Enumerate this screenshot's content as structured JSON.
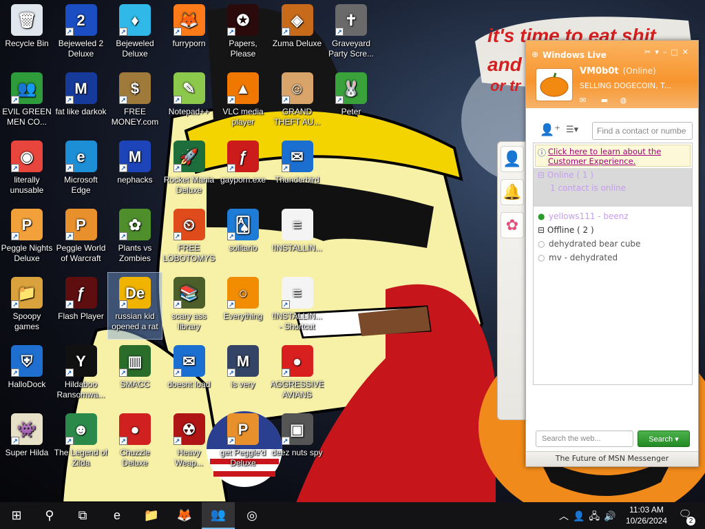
{
  "wallpaper": {
    "caption_lines": [
      "it's time to eat shit",
      "and",
      "or tr"
    ]
  },
  "desktop_icons": [
    {
      "label": "Recycle Bin",
      "icon": "recycle-bin-icon",
      "shortcut": false,
      "glyph": "🗑",
      "bg": "#dfe6ee"
    },
    {
      "label": "EVIL GREEN MEN CO...",
      "icon": "msn-buddies-icon",
      "shortcut": true,
      "glyph": "👥",
      "bg": "#2e9c3a"
    },
    {
      "label": "literally unusable",
      "icon": "chrome-icon",
      "shortcut": true,
      "glyph": "◉",
      "bg": "#e8453c"
    },
    {
      "label": "Peggle Nights Deluxe",
      "icon": "peggle-icon",
      "shortcut": true,
      "glyph": "P",
      "bg": "#f2a03a"
    },
    {
      "label": "Spoopy games",
      "icon": "folder-icon",
      "shortcut": true,
      "glyph": "📁",
      "bg": "#d9a23d"
    },
    {
      "label": "HalloDock",
      "icon": "shield-icon",
      "shortcut": true,
      "glyph": "⛨",
      "bg": "#1f6fd1"
    },
    {
      "label": "Super Hilda",
      "icon": "pixel-game-icon",
      "shortcut": true,
      "glyph": "👾",
      "bg": "#e7e1c8"
    },
    {
      "label": "Bejeweled 2 Deluxe",
      "icon": "bejeweled-2-icon",
      "shortcut": true,
      "glyph": "2",
      "bg": "#1b4ec2"
    },
    {
      "label": "fat like darkok",
      "icon": "mpl-icon",
      "shortcut": true,
      "glyph": "M",
      "bg": "#163a9a"
    },
    {
      "label": "Microsoft Edge",
      "icon": "edge-icon",
      "shortcut": true,
      "glyph": "e",
      "bg": "#1c8fd6"
    },
    {
      "label": "Peggle World of Warcraft",
      "icon": "peggle-icon",
      "shortcut": true,
      "glyph": "P",
      "bg": "#e8902c"
    },
    {
      "label": "Flash Player",
      "icon": "flash-icon",
      "shortcut": true,
      "glyph": "ƒ",
      "bg": "#5e0e0e"
    },
    {
      "label": "Hildaboo Ransomwa...",
      "icon": "ransomware-icon",
      "shortcut": true,
      "glyph": "Y",
      "bg": "#111111"
    },
    {
      "label": "The Legend of Zilda",
      "icon": "character-icon",
      "shortcut": true,
      "glyph": "☻",
      "bg": "#2b8a4a"
    },
    {
      "label": "Bejeweled Deluxe",
      "icon": "gem-icon",
      "shortcut": true,
      "glyph": "♦",
      "bg": "#2fb8e8"
    },
    {
      "label": "FREE MONEY.com",
      "icon": "money-bag-icon",
      "shortcut": true,
      "glyph": "$",
      "bg": "#a07a3a"
    },
    {
      "label": "nephacks",
      "icon": "mpi-icon",
      "shortcut": true,
      "glyph": "M",
      "bg": "#1d44b8"
    },
    {
      "label": "Plants vs Zombies",
      "icon": "plant-icon",
      "shortcut": true,
      "glyph": "✿",
      "bg": "#4e8f2c"
    },
    {
      "label": "russian kid opened a rat",
      "icon": "de-icon",
      "shortcut": true,
      "glyph": "De",
      "bg": "#f0b400",
      "selected": true
    },
    {
      "label": "SMACC",
      "icon": "bars-icon",
      "shortcut": true,
      "glyph": "▥",
      "bg": "#2a6c2a"
    },
    {
      "label": "Chuzzle Deluxe",
      "icon": "chuzzle-icon",
      "shortcut": true,
      "glyph": "●",
      "bg": "#d02020"
    },
    {
      "label": "furryporn",
      "icon": "firefox-icon",
      "shortcut": true,
      "glyph": "🦊",
      "bg": "#ff7a18"
    },
    {
      "label": "Notepad++",
      "icon": "notepad-icon",
      "shortcut": true,
      "glyph": "✎",
      "bg": "#8cc84b"
    },
    {
      "label": "Rocket Mania Deluxe",
      "icon": "rocket-icon",
      "shortcut": true,
      "glyph": "🚀",
      "bg": "#1e6e3c"
    },
    {
      "label": "FREE LOBOTOMYS",
      "icon": "clock-icon",
      "shortcut": true,
      "glyph": "⏲",
      "bg": "#e04b1c"
    },
    {
      "label": "scary ass library",
      "icon": "library-icon",
      "shortcut": true,
      "glyph": "📚",
      "bg": "#4c5f2a"
    },
    {
      "label": "doesnt load",
      "icon": "thunderbird-icon",
      "shortcut": true,
      "glyph": "✉",
      "bg": "#1b6fd1"
    },
    {
      "label": "Heavy Weap...",
      "icon": "radiation-icon",
      "shortcut": true,
      "glyph": "☢",
      "bg": "#b01515"
    },
    {
      "label": "Papers, Please",
      "icon": "papers-icon",
      "shortcut": true,
      "glyph": "✪",
      "bg": "#2a0a0a"
    },
    {
      "label": "VLC media player",
      "icon": "vlc-icon",
      "shortcut": true,
      "glyph": "▲",
      "bg": "#f07800"
    },
    {
      "label": "gayporn.exe",
      "icon": "flash-icon",
      "shortcut": true,
      "glyph": "ƒ",
      "bg": "#cc1b1b"
    },
    {
      "label": "solitario",
      "icon": "solitaire-icon",
      "shortcut": true,
      "glyph": "🂡",
      "bg": "#1e7bd6"
    },
    {
      "label": "Everything",
      "icon": "search-ring-icon",
      "shortcut": true,
      "glyph": "○",
      "bg": "#f28c00"
    },
    {
      "label": "is very",
      "icon": "mpl-icon",
      "shortcut": true,
      "glyph": "M",
      "bg": "#334466"
    },
    {
      "label": "get Peggle'd Deluxe",
      "icon": "peggle-icon",
      "shortcut": true,
      "glyph": "P",
      "bg": "#e8902c"
    },
    {
      "label": "Zuma Deluxe",
      "icon": "zuma-icon",
      "shortcut": true,
      "glyph": "◈",
      "bg": "#c76b1a"
    },
    {
      "label": "GRAND THEFT AU...",
      "icon": "character-icon",
      "shortcut": true,
      "glyph": "☺",
      "bg": "#d8a46a"
    },
    {
      "label": "Thunderbird",
      "icon": "thunderbird-icon",
      "shortcut": true,
      "glyph": "✉",
      "bg": "#1b6fd1"
    },
    {
      "label": "!INSTALLIN...",
      "icon": "document-icon",
      "shortcut": false,
      "glyph": "≡",
      "bg": "#f4f4f4"
    },
    {
      "label": "!INSTALLIN... - Shortcut",
      "icon": "document-icon",
      "shortcut": true,
      "glyph": "≡",
      "bg": "#f4f4f4"
    },
    {
      "label": "AGGRESSIVE AVIANS",
      "icon": "angry-bird-icon",
      "shortcut": true,
      "glyph": "●",
      "bg": "#d8201f"
    },
    {
      "label": "deez nuts spy",
      "icon": "windows-stack-icon",
      "shortcut": true,
      "glyph": "▣",
      "bg": "#555555"
    },
    {
      "label": "Graveyard Party Scre...",
      "icon": "graveyard-icon",
      "shortcut": true,
      "glyph": "✝",
      "bg": "#6a6a6a"
    },
    {
      "label": "Peter",
      "icon": "bunny-icon",
      "shortcut": true,
      "glyph": "🐰",
      "bg": "#3aa23a"
    }
  ],
  "msn": {
    "title": "Windows Live",
    "username": "VM0b0t",
    "status": "(Online)",
    "personal_message": "SELLING DOGECOIN, T...",
    "find_placeholder": "Find a contact or numbe",
    "banner_text_line1": "Click here to learn about the",
    "banner_text_line2": "Customer Experience.",
    "online_group": "Online ( 1 )",
    "online_summary": "1 contact is online",
    "online_contacts": [
      {
        "name": "yellows111 - beenz",
        "presence": "online"
      }
    ],
    "offline_group": "Offline ( 2 )",
    "offline_contacts": [
      {
        "name": "dehydrated bear cube",
        "presence": "offline"
      },
      {
        "name": "mv - dehydrated",
        "presence": "offline"
      }
    ],
    "web_search_placeholder": "Search the web...",
    "search_button": "Search",
    "footer": "The Future of MSN Messenger"
  },
  "taskbar": {
    "time": "11:03 AM",
    "date": "10/26/2024",
    "notification_count": "2",
    "pinned": [
      {
        "icon": "windows-start-icon",
        "glyph": "⊞"
      },
      {
        "icon": "search-icon",
        "glyph": "⚲"
      },
      {
        "icon": "task-view-icon",
        "glyph": "⧉"
      },
      {
        "icon": "edge-icon",
        "glyph": "e"
      },
      {
        "icon": "file-explorer-icon",
        "glyph": "📁"
      },
      {
        "icon": "firefox-icon",
        "glyph": "🦊"
      },
      {
        "icon": "msn-buddies-icon",
        "glyph": "👥",
        "active": true
      },
      {
        "icon": "app-icon",
        "glyph": "◎"
      }
    ]
  }
}
